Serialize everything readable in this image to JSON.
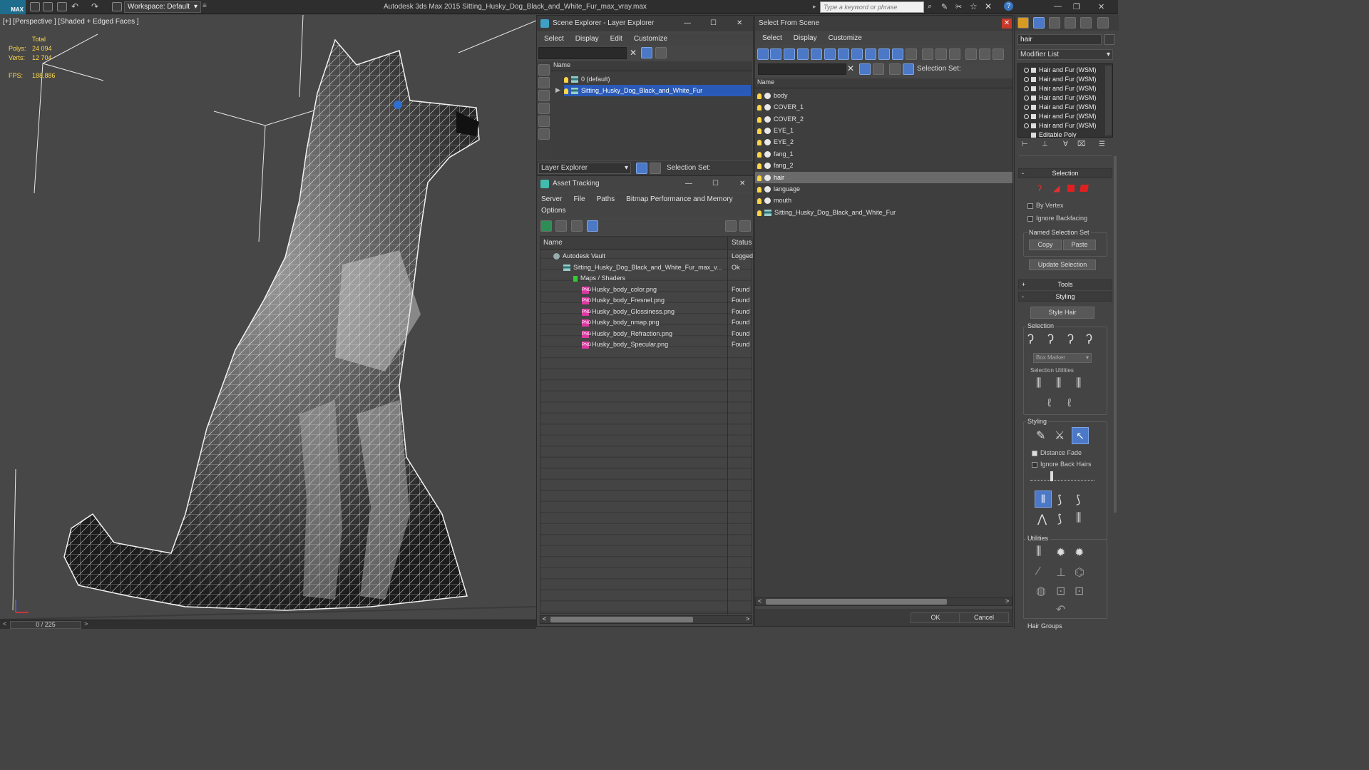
{
  "titlebar": {
    "app_logo": "MAX",
    "workspace": "Workspace: Default",
    "title": "Autodesk 3ds Max  2015    Sitting_Husky_Dog_Black_and_White_Fur_max_vray.max",
    "search_placeholder": "Type a keyword or phrase"
  },
  "viewport": {
    "label": "[+] [Perspective ] [Shaded + Edged Faces ]",
    "stats": {
      "total_label": "Total",
      "polys_label": "Polys:",
      "polys_value": "24 094",
      "verts_label": "Verts:",
      "verts_value": "12 704",
      "fps_label": "FPS:",
      "fps_value": "188,886"
    },
    "time_slider": "0 / 225"
  },
  "scene_explorer": {
    "title": "Scene Explorer - Layer Explorer",
    "menu": [
      "Select",
      "Display",
      "Edit",
      "Customize"
    ],
    "column_name": "Name",
    "rows": [
      "0 (default)",
      "Sitting_Husky_Dog_Black_and_White_Fur"
    ],
    "footer_label": "Layer Explorer",
    "selection_set_label": "Selection Set:"
  },
  "asset_tracking": {
    "title": "Asset Tracking",
    "menu": [
      "Server",
      "File",
      "Paths",
      "Bitmap Performance and Memory"
    ],
    "menu2": "Options",
    "col_name": "Name",
    "col_status": "Status",
    "rows": [
      {
        "name": "Autodesk Vault",
        "status": "Logged"
      },
      {
        "name": "Sitting_Husky_Dog_Black_and_White_Fur_max_v...",
        "status": "Ok"
      },
      {
        "name": "Maps / Shaders",
        "status": ""
      },
      {
        "name": "Husky_body_color.png",
        "status": "Found"
      },
      {
        "name": "Husky_body_Fresnel.png",
        "status": "Found"
      },
      {
        "name": "Husky_body_Glossiness.png",
        "status": "Found"
      },
      {
        "name": "Husky_body_nmap.png",
        "status": "Found"
      },
      {
        "name": "Husky_body_Refraction.png",
        "status": "Found"
      },
      {
        "name": "Husky_body_Specular.png",
        "status": "Found"
      }
    ]
  },
  "select_from_scene": {
    "title": "Select From Scene",
    "menu": [
      "Select",
      "Display",
      "Customize"
    ],
    "selection_set_label": "Selection Set:",
    "column_name": "Name",
    "rows": [
      "body",
      "COVER_1",
      "COVER_2",
      "EYE_1",
      "EYE_2",
      "fang_1",
      "fang_2",
      "hair",
      "language",
      "mouth",
      "Sitting_Husky_Dog_Black_and_White_Fur"
    ],
    "selected": "hair",
    "ok_label": "OK",
    "cancel_label": "Cancel"
  },
  "command_panel": {
    "object_name": "hair",
    "modifier_list": "Modifier List",
    "modifiers": [
      "Hair and Fur (WSM)",
      "Hair and Fur (WSM)",
      "Hair and Fur (WSM)",
      "Hair and Fur (WSM)",
      "Hair and Fur (WSM)",
      "Hair and Fur (WSM)",
      "Hair and Fur (WSM)",
      "Editable Poly"
    ],
    "selection_rollout": "Selection",
    "by_vertex": "By Vertex",
    "ignore_backfacing": "Ignore Backfacing",
    "named_selection_set": "Named Selection Set",
    "copy": "Copy",
    "paste": "Paste",
    "update_selection": "Update Selection",
    "tools_rollout": "Tools",
    "styling_rollout": "Styling",
    "style_hair": "Style Hair",
    "selection_group": "Selection",
    "box_marker": "Box Marker",
    "selection_utilities": "Selection Utilities",
    "styling_group": "Styling",
    "distance_fade": "Distance Fade",
    "ignore_back_hairs": "Ignore Back Hairs",
    "utilities_group": "Utilities",
    "hair_groups": "Hair Groups"
  }
}
